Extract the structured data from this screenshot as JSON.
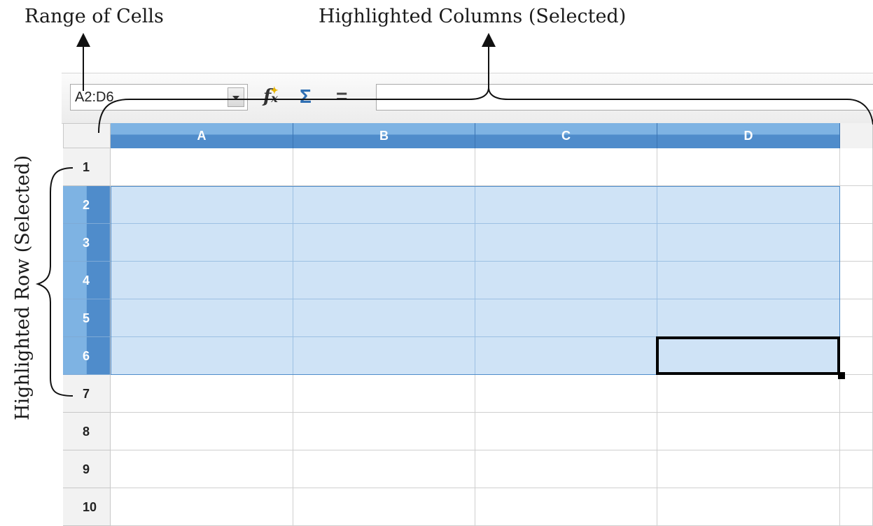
{
  "annotations": {
    "range_of_cells": "Range of Cells",
    "highlighted_columns": "Highlighted Columns (Selected)",
    "highlighted_row": "Highlighted Row (Selected)"
  },
  "toolbar": {
    "name_box_value": "A2:D6",
    "function_wizard_icon": "fx-icon",
    "sum_icon": "sigma-icon",
    "formula_icon": "equals-icon",
    "formula_input_value": ""
  },
  "sheet": {
    "columns": [
      "A",
      "B",
      "C",
      "D"
    ],
    "rows": [
      "1",
      "2",
      "3",
      "4",
      "5",
      "6",
      "7",
      "8",
      "9",
      "10"
    ],
    "selected_columns": [
      "A",
      "B",
      "C",
      "D"
    ],
    "selected_rows": [
      "2",
      "3",
      "4",
      "5",
      "6"
    ],
    "active_cell": "D6"
  },
  "colors": {
    "selection_fill": "#cfe3f6",
    "header_selected": "#4f8ccb",
    "header_selected_light": "#7eb3e3"
  }
}
